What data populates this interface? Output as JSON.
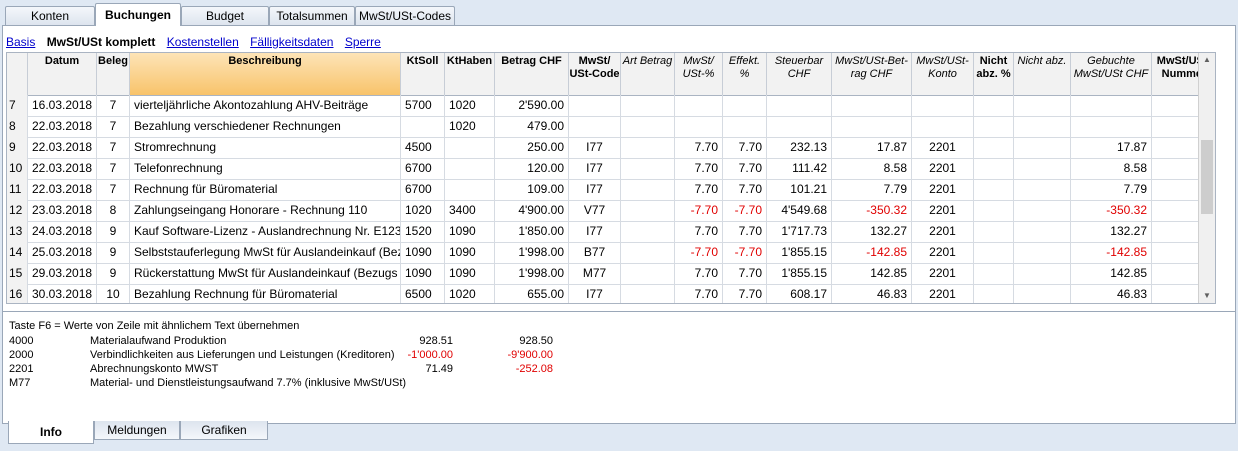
{
  "tabs": [
    "Konten",
    "Buchungen",
    "Budget",
    "Totalsummen",
    "MwSt/USt-Codes"
  ],
  "active_tab": "Buchungen",
  "views": [
    "Basis",
    "MwSt/USt komplett",
    "Kostenstellen",
    "Fälligkeitsdaten",
    "Sperre"
  ],
  "active_view": "MwSt/USt komplett",
  "columns": {
    "datum": "Datum",
    "beleg": "Beleg",
    "beschreibung": "Beschreibung",
    "ktsoll": "KtSoll",
    "kthaben": "KtHaben",
    "betrag": "Betrag CHF",
    "mwst_code_1": "MwSt/",
    "mwst_code_2": "USt-Code",
    "art_betrag": "Art Betrag",
    "mwst_pct_1": "MwSt/",
    "mwst_pct_2": "USt-%",
    "effekt": "Effekt. %",
    "steuerbar_1": "Steuerbar",
    "steuerbar_2": "CHF",
    "mwst_betrag_1": "MwSt/USt-Bet-",
    "mwst_betrag_2": "rag CHF",
    "mwst_konto_1": "MwSt/USt-",
    "mwst_konto_2": "Konto",
    "nicht_abz_pct_1": "Nicht",
    "nicht_abz_pct_2": "abz. %",
    "nicht_abz": "Nicht abz.",
    "gebucht_1": "Gebuchte",
    "gebucht_2": "MwSt/USt CHF",
    "nummer_1": "MwSt/USt-",
    "nummer_2": "Nummer"
  },
  "rows": [
    {
      "n": "7",
      "datum": "16.03.2018",
      "beleg": "7",
      "desc": "vierteljährliche Akontozahlung AHV-Beiträge",
      "soll": "5700",
      "haben": "1020",
      "betrag": "2'590.00",
      "code": "",
      "pct": "",
      "eff": "",
      "steuerbar": "",
      "mwst": "",
      "konto": "",
      "gebucht": ""
    },
    {
      "n": "8",
      "datum": "22.03.2018",
      "beleg": "7",
      "desc": "Bezahlung verschiedener Rechnungen",
      "soll": "",
      "haben": "1020",
      "betrag": "479.00",
      "code": "",
      "pct": "",
      "eff": "",
      "steuerbar": "",
      "mwst": "",
      "konto": "",
      "gebucht": ""
    },
    {
      "n": "9",
      "datum": "22.03.2018",
      "beleg": "7",
      "desc": "Stromrechnung",
      "soll": "4500",
      "haben": "",
      "betrag": "250.00",
      "code": "I77",
      "pct": "7.70",
      "eff": "7.70",
      "steuerbar": "232.13",
      "mwst": "17.87",
      "konto": "2201",
      "gebucht": "17.87"
    },
    {
      "n": "10",
      "datum": "22.03.2018",
      "beleg": "7",
      "desc": "Telefonrechnung",
      "soll": "6700",
      "haben": "",
      "betrag": "120.00",
      "code": "I77",
      "pct": "7.70",
      "eff": "7.70",
      "steuerbar": "111.42",
      "mwst": "8.58",
      "konto": "2201",
      "gebucht": "8.58"
    },
    {
      "n": "11",
      "datum": "22.03.2018",
      "beleg": "7",
      "desc": "Rechnung für Büromaterial",
      "soll": "6700",
      "haben": "",
      "betrag": "109.00",
      "code": "I77",
      "pct": "7.70",
      "eff": "7.70",
      "steuerbar": "101.21",
      "mwst": "7.79",
      "konto": "2201",
      "gebucht": "7.79"
    },
    {
      "n": "12",
      "datum": "23.03.2018",
      "beleg": "8",
      "desc": "Zahlungseingang Honorare - Rechnung 110",
      "soll": "1020",
      "haben": "3400",
      "betrag": "4'900.00",
      "code": "V77",
      "pct": "-7.70",
      "eff": "-7.70",
      "steuerbar": "4'549.68",
      "mwst": "-350.32",
      "konto": "2201",
      "gebucht": "-350.32"
    },
    {
      "n": "13",
      "datum": "24.03.2018",
      "beleg": "9",
      "desc": "Kauf Software-Lizenz - Auslandrechnung Nr. E123",
      "soll": "1520",
      "haben": "1090",
      "betrag": "1'850.00",
      "code": "I77",
      "pct": "7.70",
      "eff": "7.70",
      "steuerbar": "1'717.73",
      "mwst": "132.27",
      "konto": "2201",
      "gebucht": "132.27"
    },
    {
      "n": "14",
      "datum": "25.03.2018",
      "beleg": "9",
      "desc": "Selbststauferlegung MwSt für Auslandeinkauf (Bezu",
      "soll": "1090",
      "haben": "1090",
      "betrag": "1'998.00",
      "code": "B77",
      "pct": "-7.70",
      "eff": "-7.70",
      "steuerbar": "1'855.15",
      "mwst": "-142.85",
      "konto": "2201",
      "gebucht": "-142.85"
    },
    {
      "n": "15",
      "datum": "29.03.2018",
      "beleg": "9",
      "desc": "Rückerstattung MwSt für Auslandeinkauf (Bezugs",
      "soll": "1090",
      "haben": "1090",
      "betrag": "1'998.00",
      "code": "M77",
      "pct": "7.70",
      "eff": "7.70",
      "steuerbar": "1'855.15",
      "mwst": "142.85",
      "konto": "2201",
      "gebucht": "142.85"
    },
    {
      "n": "16",
      "datum": "30.03.2018",
      "beleg": "10",
      "desc": "Bezahlung Rechnung für Büromaterial",
      "soll": "6500",
      "haben": "1020",
      "betrag": "655.00",
      "code": "I77",
      "pct": "7.70",
      "eff": "7.70",
      "steuerbar": "608.17",
      "mwst": "46.83",
      "konto": "2201",
      "gebucht": "46.83"
    }
  ],
  "info": {
    "hint": "Taste F6 = Werte von Zeile mit ähnlichem Text übernehmen",
    "lines": [
      {
        "code": "4000",
        "text": "Materialaufwand Produktion",
        "v1": "928.51",
        "v2": "928.50"
      },
      {
        "code": "2000",
        "text": "Verbindlichkeiten aus Lieferungen und Leistungen (Kreditoren)",
        "v1": "-1'000.00",
        "v2": "-9'900.00"
      },
      {
        "code": "2201",
        "text": "Abrechnungskonto MWST",
        "v1": "71.49",
        "v2": "-252.08"
      },
      {
        "code": "M77",
        "text": "Material- und Dienstleistungsaufwand 7.7% (inklusive MwSt/USt)",
        "v1": "",
        "v2": ""
      }
    ]
  },
  "bottom_tabs": [
    "Info",
    "Meldungen",
    "Grafiken"
  ],
  "active_bottom_tab": "Info",
  "colors": {
    "negative": "#e00000",
    "header_highlight": "#f8c36a",
    "link": "#0000cc"
  }
}
